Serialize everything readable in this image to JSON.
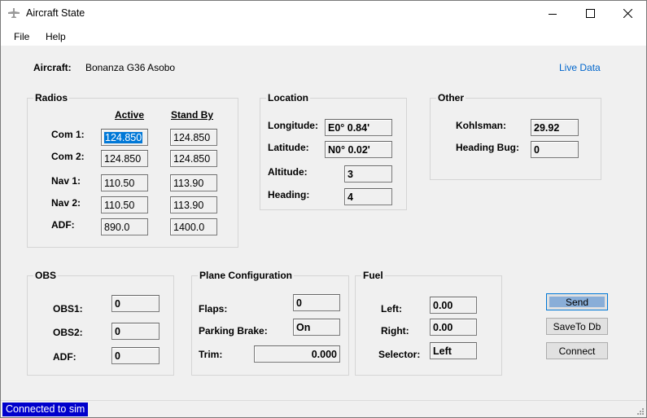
{
  "window": {
    "title": "Aircraft State"
  },
  "menu": {
    "file": "File",
    "help": "Help"
  },
  "aircraft": {
    "label": "Aircraft:",
    "name": "Bonanza G36 Asobo",
    "live_data": "Live Data"
  },
  "radios": {
    "title": "Radios",
    "col_active": "Active",
    "col_standby": "Stand By",
    "rows": [
      {
        "label": "Com 1:",
        "active": "124.850",
        "standby": "124.850"
      },
      {
        "label": "Com 2:",
        "active": "124.850",
        "standby": "124.850"
      },
      {
        "label": "Nav 1:",
        "active": "110.50",
        "standby": "113.90"
      },
      {
        "label": "Nav 2:",
        "active": "110.50",
        "standby": "113.90"
      },
      {
        "label": "ADF:",
        "active": "890.0",
        "standby": "1400.0"
      }
    ]
  },
  "location": {
    "title": "Location",
    "longitude_label": "Longitude:",
    "longitude": "E0° 0.84'",
    "latitude_label": "Latitude:",
    "latitude": "N0° 0.02'",
    "altitude_label": "Altitude:",
    "altitude": "3",
    "heading_label": "Heading:",
    "heading": "4"
  },
  "other": {
    "title": "Other",
    "kohlsman_label": "Kohlsman:",
    "kohlsman": "29.92",
    "heading_bug_label": "Heading Bug:",
    "heading_bug": "0"
  },
  "obs": {
    "title": "OBS",
    "obs1_label": "OBS1:",
    "obs1": "0",
    "obs2_label": "OBS2:",
    "obs2": "0",
    "adf_label": "ADF:",
    "adf": "0"
  },
  "plane": {
    "title": "Plane Configuration",
    "flaps_label": "Flaps:",
    "flaps": "0",
    "parking_label": "Parking Brake:",
    "parking": "On",
    "trim_label": "Trim:",
    "trim": "0.000"
  },
  "fuel": {
    "title": "Fuel",
    "left_label": "Left:",
    "left": "0.00",
    "right_label": "Right:",
    "right": "0.00",
    "selector_label": "Selector:",
    "selector": "Left"
  },
  "buttons": {
    "send": "Send",
    "save": "SaveTo Db",
    "connect": "Connect"
  },
  "status": {
    "text": "Connected to sim"
  }
}
